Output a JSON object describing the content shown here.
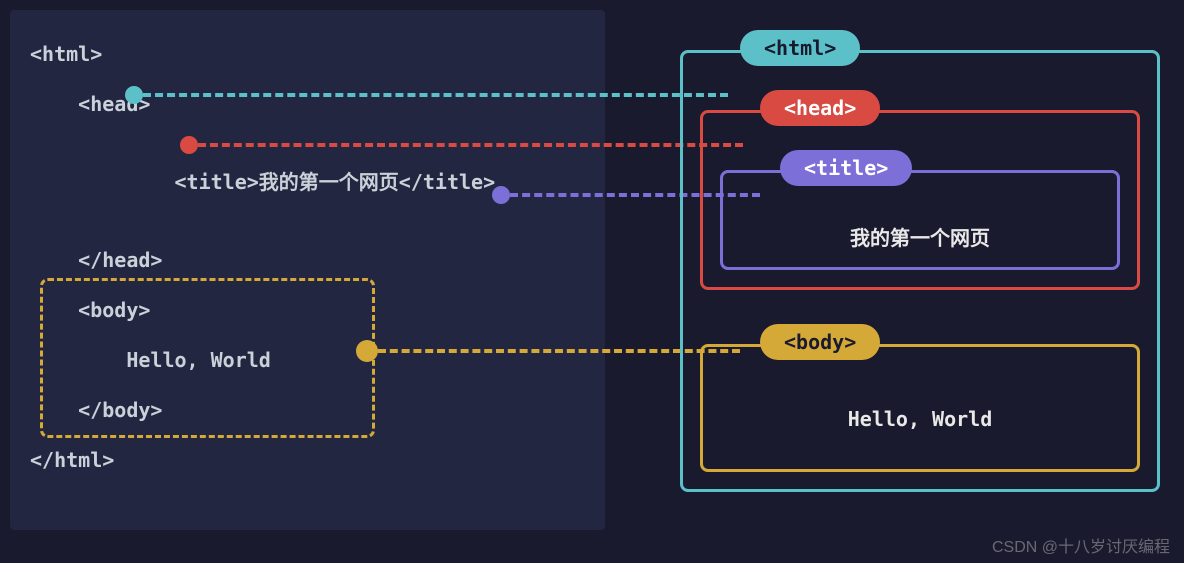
{
  "code": {
    "l1": "<html>",
    "l2": "    <head>",
    "l3_open": "        <title>",
    "l3_text": "我的第一个网页",
    "l3_close": "</title>",
    "l4": "    </head>",
    "l5": "    <body>",
    "l6": "        Hello, World",
    "l7": "    </body>",
    "l8": "</html>"
  },
  "diagram": {
    "html_label": "<html>",
    "head_label": "<head>",
    "title_label": "<title>",
    "title_content": "我的第一个网页",
    "body_label": "<body>",
    "body_content": "Hello, World"
  },
  "colors": {
    "teal": "#5bc0c8",
    "red": "#d84a42",
    "purple": "#7c6fd8",
    "yellow": "#d4a938"
  },
  "watermark": "CSDN @十八岁讨厌编程"
}
